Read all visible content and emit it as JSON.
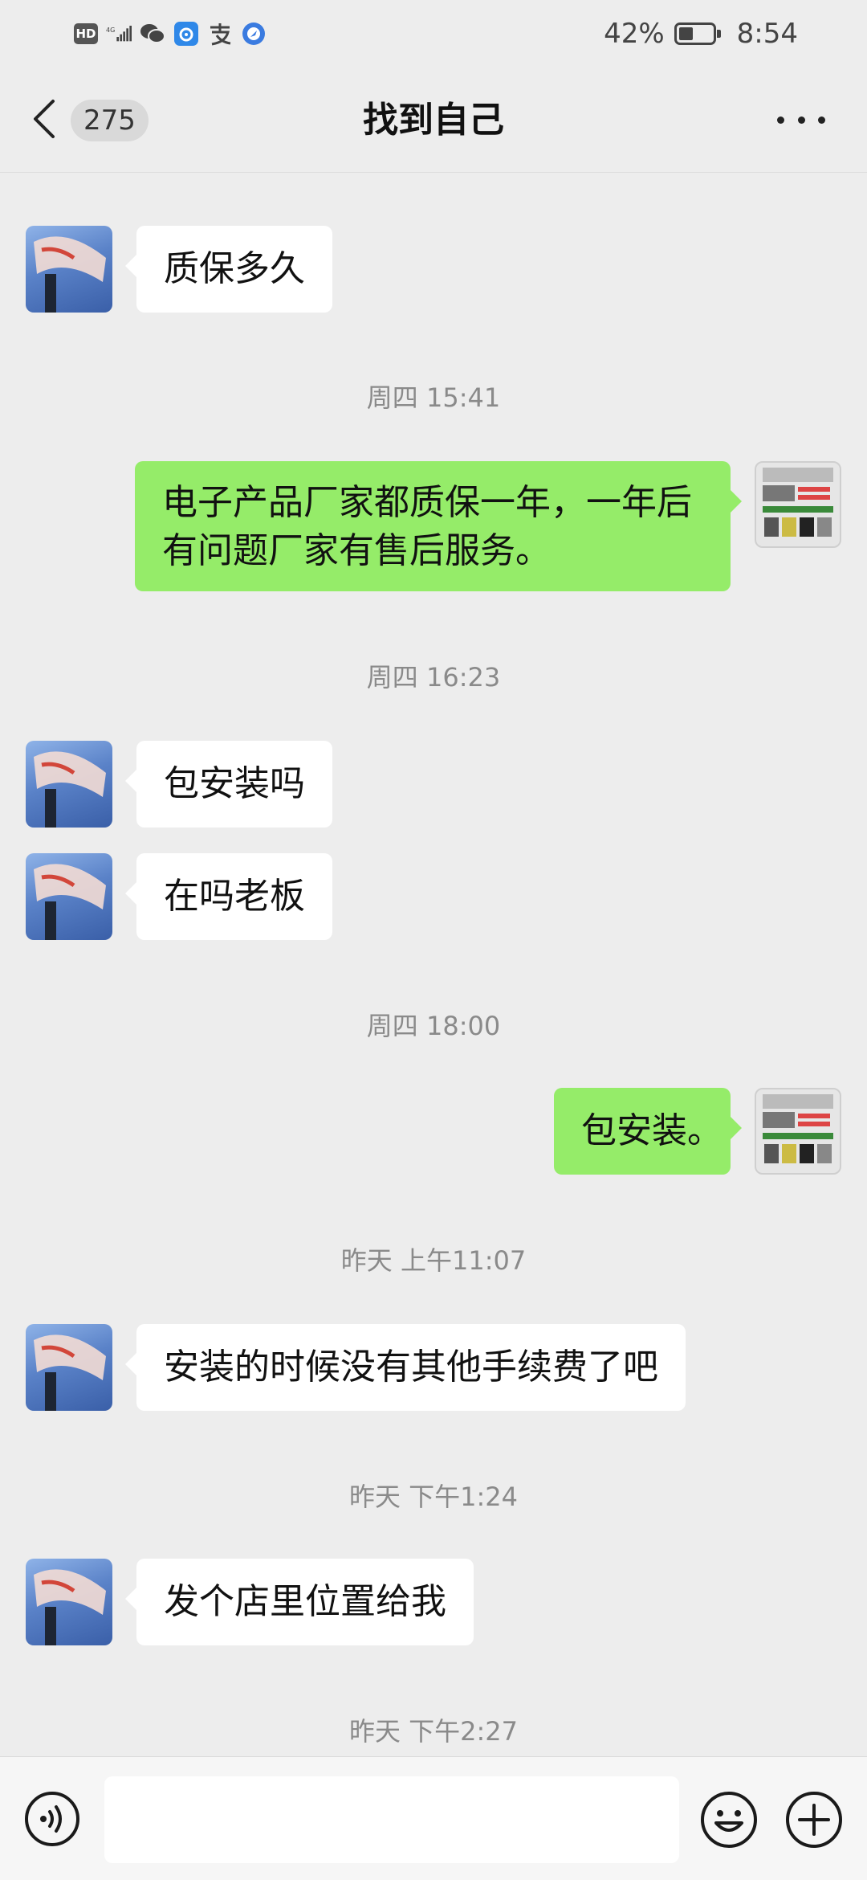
{
  "status_bar": {
    "hd_label": "HD",
    "network_label": "4G",
    "battery_text": "42%",
    "battery_level": 0.42,
    "time": "8:54"
  },
  "header": {
    "unread_count": "275",
    "title": "找到自己"
  },
  "messages": [
    {
      "type": "in",
      "text": "质保多久"
    },
    {
      "type": "time",
      "text": "周四 15:41"
    },
    {
      "type": "out",
      "text_line1": "电子产品厂家都质保一年，一年后",
      "text_line2": "有问题厂家有售后服务。"
    },
    {
      "type": "time",
      "text": "周四 16:23"
    },
    {
      "type": "in",
      "text": "包安装吗"
    },
    {
      "type": "in",
      "text": "在吗老板"
    },
    {
      "type": "time",
      "text": "周四 18:00"
    },
    {
      "type": "out",
      "text": "包安装。"
    },
    {
      "type": "time",
      "text": "昨天 上午11:07"
    },
    {
      "type": "in",
      "text": "安装的时候没有其他手续费了吧"
    },
    {
      "type": "time",
      "text": "昨天 下午1:24"
    },
    {
      "type": "in",
      "text": "发个店里位置给我"
    },
    {
      "type": "time",
      "text": "昨天 下午2:27"
    }
  ],
  "input_bar": {
    "placeholder": ""
  },
  "colors": {
    "background": "#ededed",
    "outgoing_bubble": "#95ec69",
    "incoming_bubble": "#ffffff"
  }
}
